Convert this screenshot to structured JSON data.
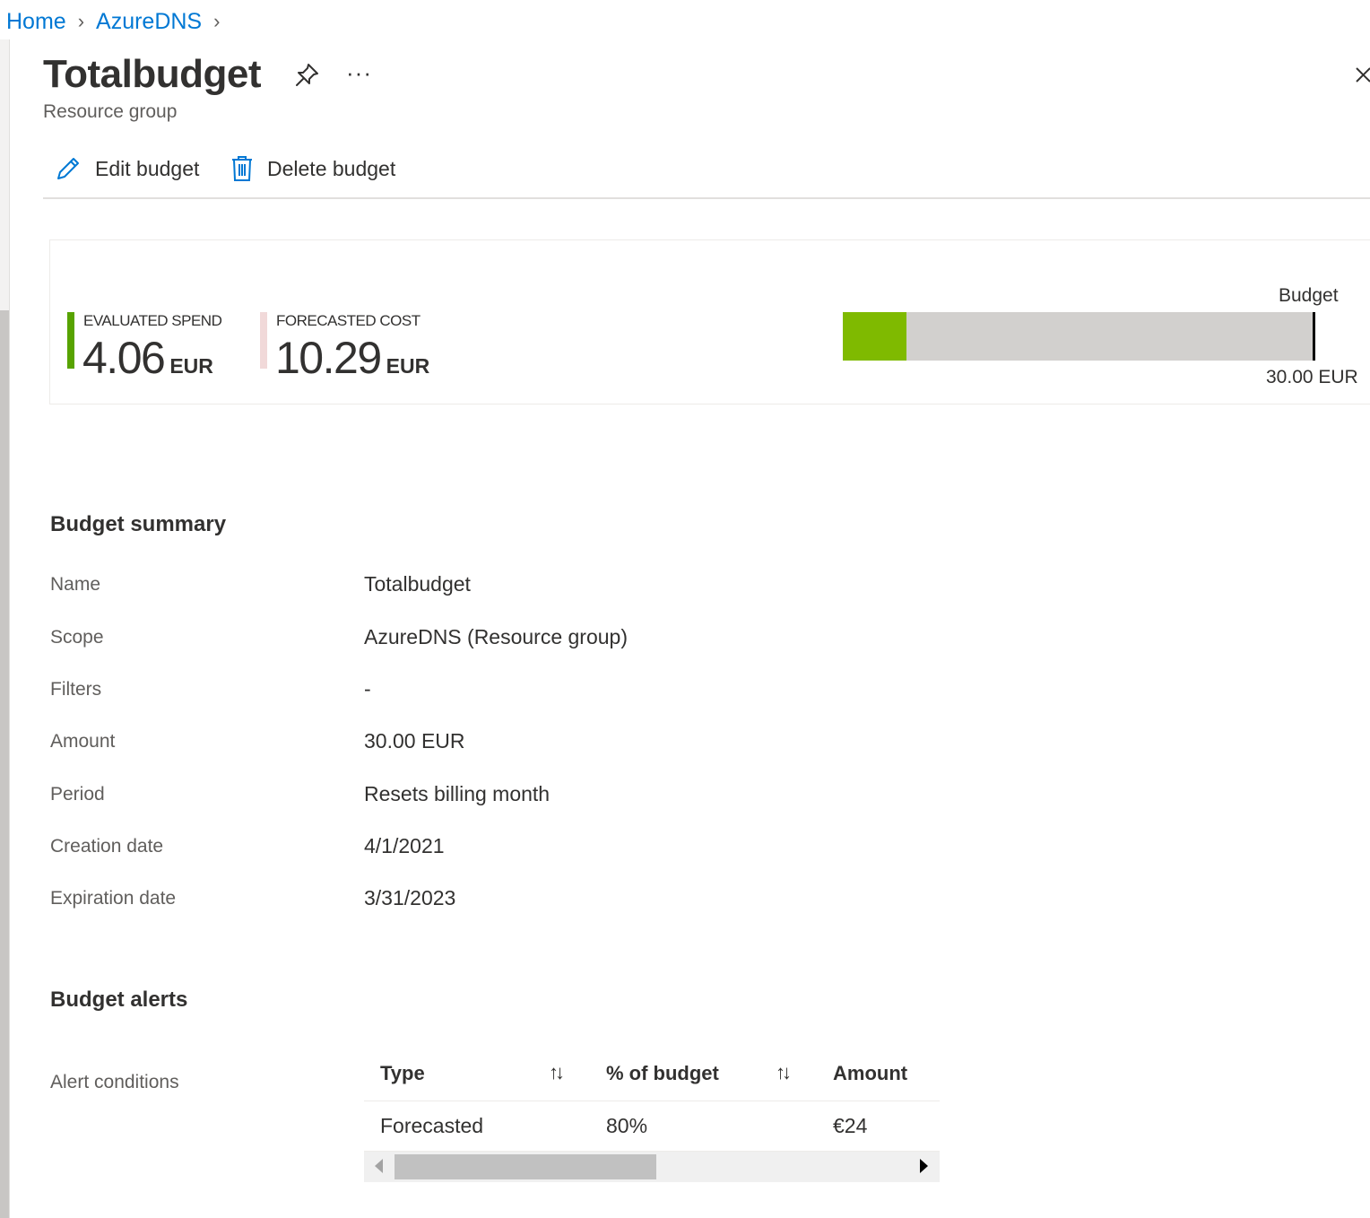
{
  "breadcrumb": {
    "items": [
      {
        "label": "Home"
      },
      {
        "label": "AzureDNS"
      }
    ]
  },
  "header": {
    "title": "Totalbudget",
    "subtitle": "Resource group",
    "more_label": "···"
  },
  "toolbar": {
    "edit_label": "Edit budget",
    "delete_label": "Delete budget"
  },
  "summary_card": {
    "evaluated": {
      "label": "EVALUATED SPEND",
      "value": "4.06",
      "unit": "EUR",
      "color": "#57a300"
    },
    "forecasted": {
      "label": "FORECASTED COST",
      "value": "10.29",
      "unit": "EUR",
      "color": "#f1d9d9"
    },
    "budget_label": "Budget",
    "budget_amount": "30.00 EUR",
    "spend_fraction": 0.135,
    "bar_fill_color": "#7fba00",
    "bar_track_color": "#d2d0ce"
  },
  "budget_summary": {
    "heading": "Budget summary",
    "rows": [
      {
        "label": "Name",
        "value": "Totalbudget"
      },
      {
        "label": "Scope",
        "value": "AzureDNS (Resource group)"
      },
      {
        "label": "Filters",
        "value": "-"
      },
      {
        "label": "Amount",
        "value": "30.00 EUR"
      },
      {
        "label": "Period",
        "value": "Resets billing month"
      },
      {
        "label": "Creation date",
        "value": "4/1/2021"
      },
      {
        "label": "Expiration date",
        "value": "3/31/2023"
      }
    ]
  },
  "budget_alerts": {
    "heading": "Budget alerts",
    "conditions_label": "Alert conditions",
    "columns": [
      "Type",
      "% of budget",
      "Amount"
    ],
    "sort_glyph": "↑↓",
    "rows": [
      {
        "type": "Forecasted",
        "percent": "80%",
        "amount": "€24"
      }
    ]
  }
}
